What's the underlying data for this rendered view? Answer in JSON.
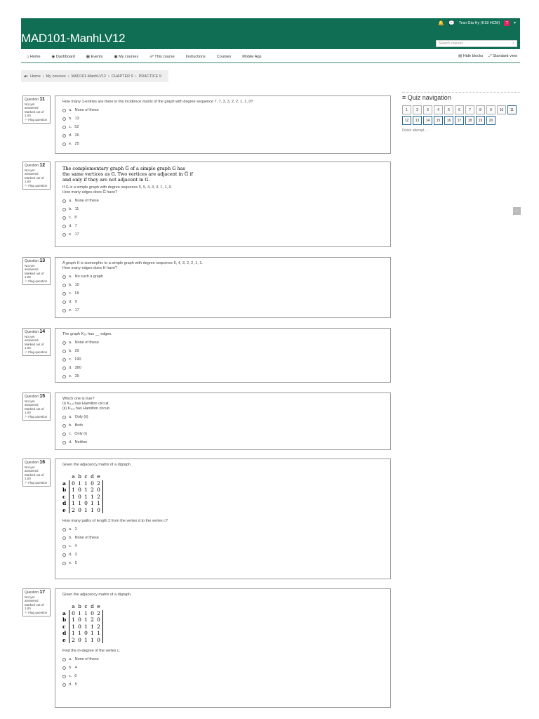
{
  "topbar": {
    "bell_icon": "bell-icon",
    "chat_icon": "chat-icon",
    "user": "Tran Gia Hy (K18 HCM)",
    "avatar_letter": "T"
  },
  "site": {
    "title": "MAD101-ManhLV12",
    "search_placeholder": "Search courses"
  },
  "nav": {
    "items": [
      "Home",
      "Dashboard",
      "Events",
      "My courses",
      "This course",
      "Instructions",
      "Courses",
      "Mobile App"
    ],
    "hide_blocks": "Hide blocks",
    "standard_view": "Standard view"
  },
  "breadcrumb": [
    "Home",
    "My courses",
    "MAD101-ManhLV12",
    "CHAPTER 9",
    "PRACTICE 9"
  ],
  "quiz_nav": {
    "title": "Quiz navigation",
    "numbers": [
      "1",
      "2",
      "3",
      "4",
      "5",
      "6",
      "7",
      "8",
      "9",
      "10",
      "11",
      "12",
      "13",
      "14",
      "15",
      "16",
      "17",
      "18",
      "19",
      "20"
    ],
    "finish": "Finish attempt ..."
  },
  "info": {
    "label": "Question",
    "status": "Not yet answered",
    "marked": "Marked out of 1.00",
    "flag": "Flag question"
  },
  "questions": [
    {
      "num": "11",
      "text": "How many 1-entries are there in the incidence matrix of the graph with degree sequence 7, 7, 3, 3, 2, 2, 1, 1, 0?",
      "options": [
        [
          "a.",
          "None of these"
        ],
        [
          "b.",
          "13"
        ],
        [
          "c.",
          "52"
        ],
        [
          "d.",
          "26"
        ],
        [
          "e.",
          "25"
        ]
      ]
    },
    {
      "num": "12",
      "def1": "The complementary graph G̅ of a simple graph G has",
      "def2": "the same vertices as G. Two vertices are adjacent in G̅ if",
      "def3": "and only if they are not adjacent in G.",
      "text": "If G is a simple graph with degree sequence 5, 5, 4, 3, 3, 1, 1, 0.",
      "text2": "How many edges does  G̅  have?",
      "options": [
        [
          "a.",
          "None of these"
        ],
        [
          "b.",
          "11"
        ],
        [
          "c.",
          "8"
        ],
        [
          "d.",
          "7"
        ],
        [
          "e.",
          "17"
        ]
      ]
    },
    {
      "num": "13",
      "text": "A graph H is isomorphic to a simple graph with degree sequence 5, 4, 3, 2, 2, 1, 1.",
      "text2": "How many edges does H have?",
      "options": [
        [
          "a.",
          "No such a graph"
        ],
        [
          "b.",
          "10"
        ],
        [
          "c.",
          "18"
        ],
        [
          "d.",
          "9"
        ],
        [
          "e.",
          "17"
        ]
      ]
    },
    {
      "num": "14",
      "text": "The graph K₂₀ has __ edges.",
      "options": [
        [
          "a.",
          "None of these"
        ],
        [
          "b.",
          "20"
        ],
        [
          "c.",
          "190"
        ],
        [
          "d.",
          "380"
        ],
        [
          "e.",
          "39"
        ]
      ]
    },
    {
      "num": "15",
      "text": "Which one is true?",
      "text2": "(i) K₂,₃ has Hamilton circuit.",
      "text3": "(ii) K₃,₃ has Hamilton circuit.",
      "options": [
        [
          "a.",
          "Only (ii)"
        ],
        [
          "b.",
          "Both"
        ],
        [
          "c.",
          "Only (i)"
        ],
        [
          "d.",
          "Neither"
        ]
      ]
    },
    {
      "num": "16",
      "text": "Given the adjacency matrix of a digraph.",
      "text2": "How many paths of length 2 from the vertex d to the vertex c?",
      "options": [
        [
          "a.",
          "2"
        ],
        [
          "b.",
          "None of these"
        ],
        [
          "c.",
          "4"
        ],
        [
          "d.",
          "3"
        ],
        [
          "e.",
          "5"
        ]
      ]
    },
    {
      "num": "17",
      "text": "Given the adjacency matrix of a digraph.",
      "text2": "Find the in-degree of the vertex c.",
      "options": [
        [
          "a.",
          "None of these"
        ],
        [
          "b.",
          "4"
        ],
        [
          "c.",
          "6"
        ],
        [
          "d.",
          "5"
        ]
      ]
    }
  ],
  "matrix": {
    "cols": [
      "a",
      "b",
      "c",
      "d",
      "e"
    ],
    "rows": [
      [
        "a",
        "0",
        "1",
        "1",
        "0",
        "2"
      ],
      [
        "b",
        "1",
        "0",
        "1",
        "2",
        "0"
      ],
      [
        "c",
        "1",
        "0",
        "1",
        "1",
        "2"
      ],
      [
        "d",
        "1",
        "1",
        "0",
        "1",
        "1"
      ],
      [
        "e",
        "2",
        "0",
        "1",
        "1",
        "0"
      ]
    ]
  }
}
